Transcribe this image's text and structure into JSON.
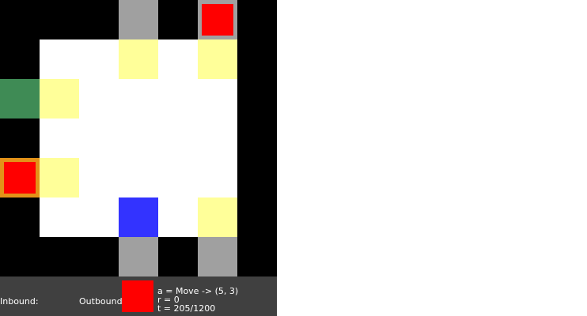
{
  "board": {
    "columns": 7,
    "rows": 7,
    "legend": {
      "W": "wall",
      ".": "floor",
      "P": "port",
      "Y": "pad",
      "G": "goal",
      "B": "robot",
      "O": "held"
    },
    "colors": {
      "wall": "#000000",
      "floor": "#ffffff",
      "port": "#a0a0a0",
      "pad": "#ffff99",
      "goal": "#3f8b55",
      "robot": "#3333ff",
      "held": "#e39218",
      "package": "#ff0000"
    },
    "grid": [
      "WWWPWPW",
      "W..Y.YW",
      "GY....W",
      "W.....W",
      "OY....W",
      "W..B.YW",
      "WWWPWPW"
    ],
    "packages": [
      {
        "row": 0,
        "col": 5
      },
      {
        "row": 4,
        "col": 0
      }
    ]
  },
  "hud": {
    "inbound_label": "Inbound:",
    "outbound_label": "Outbound:",
    "outbound_color": "#ff0000",
    "action": "a = Move -> (5, 3)",
    "reward": "r = 0",
    "time": "t = 205/1200"
  }
}
